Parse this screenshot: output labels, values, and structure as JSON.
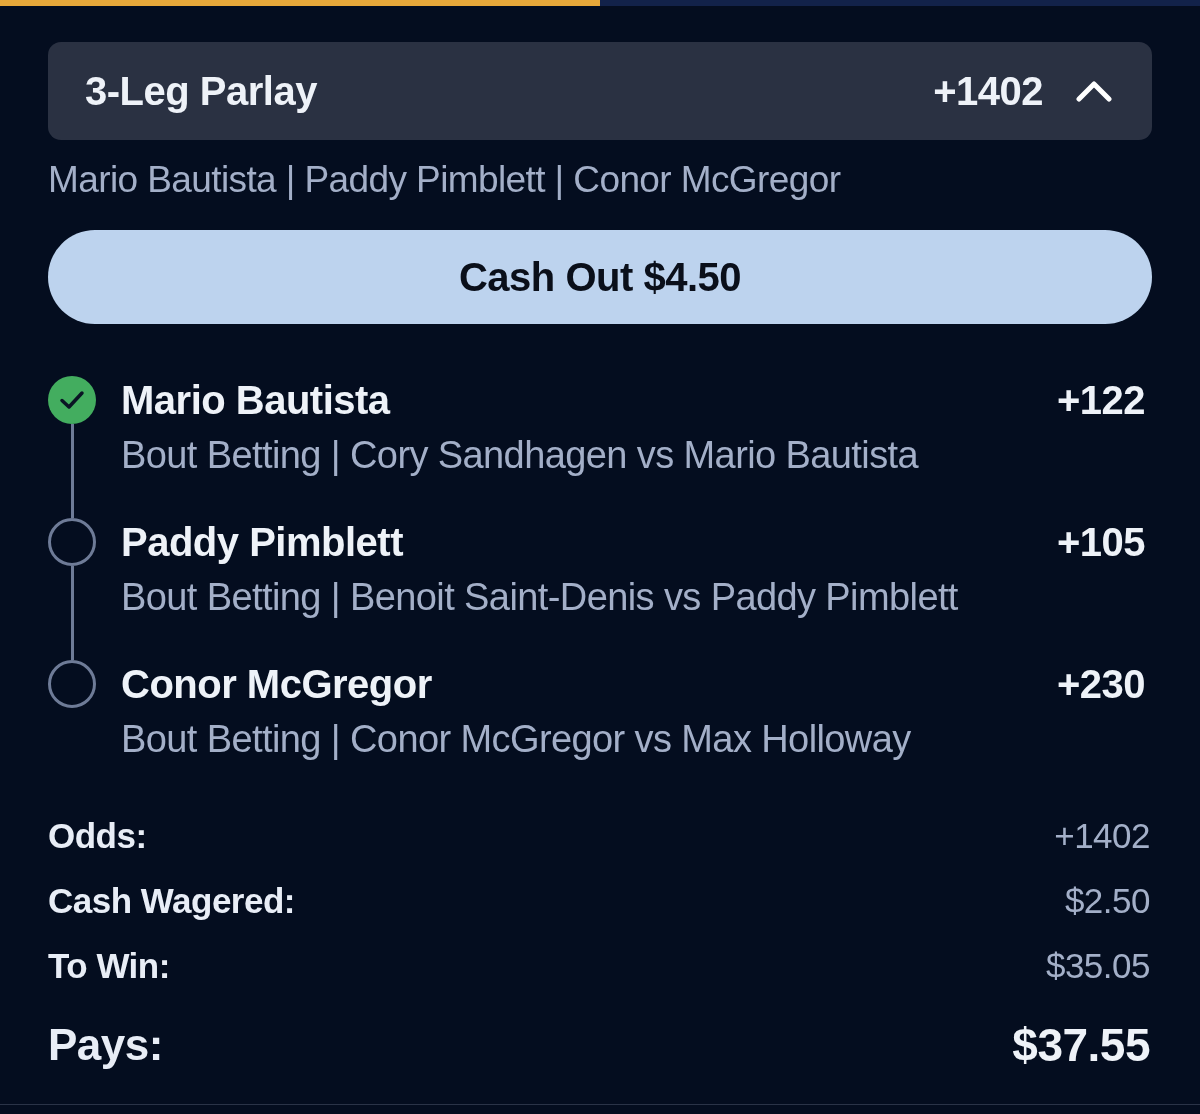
{
  "progress": {
    "level": 0.5
  },
  "parlay": {
    "title": "3-Leg Parlay",
    "odds": "+1402",
    "expanded": true
  },
  "selections_summary": "Mario Bautista | Paddy Pimblett | Conor McGregor",
  "cash_out_button": "Cash Out $4.50",
  "legs": [
    {
      "name": "Mario Bautista",
      "market": "Bout Betting | Cory Sandhagen vs Mario Bautista",
      "odds": "+122",
      "won": true
    },
    {
      "name": "Paddy Pimblett",
      "market": "Bout Betting | Benoit Saint-Denis vs Paddy Pimblett",
      "odds": "+105",
      "won": false
    },
    {
      "name": "Conor McGregor",
      "market": "Bout Betting | Conor McGregor vs Max Holloway",
      "odds": "+230",
      "won": false
    }
  ],
  "summary": [
    {
      "kind": "line",
      "label": "Odds:",
      "value": "+1402"
    },
    {
      "kind": "line",
      "label": "Cash Wagered:",
      "value": "$2.50"
    },
    {
      "kind": "line",
      "label": "To Win:",
      "value": "$35.05"
    },
    {
      "kind": "total",
      "label": "Pays:",
      "value": "$37.55"
    }
  ]
}
